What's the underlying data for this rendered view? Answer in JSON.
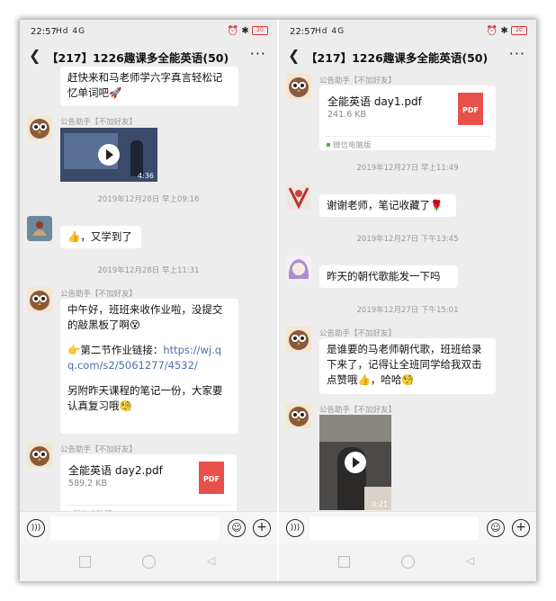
{
  "status": {
    "time": "22:57",
    "signal": "Hd 4G",
    "icons": "⏰ ✱",
    "battery": "20"
  },
  "chat": {
    "title": "【217】1226趣课多全能英语(50)",
    "back_icon": "chevron-left-icon",
    "more_icon": "more-icon"
  },
  "left": {
    "msg_top": "赶快来和马老师学六字真言轻松记忆单词吧🚀",
    "sender1": "公告助手【不加好友】",
    "video1_duration": "4:36",
    "time1": "2019年12月28日 早上09:16",
    "msg_student": "👍，又学到了",
    "time2": "2019年12月28日 早上11:31",
    "sender2": "公告助手【不加好友】",
    "msg_hw_1": "中午好，班班来收作业啦，没提交的敲黑板了啊😵",
    "msg_hw_2": "👉第二节作业链接：",
    "msg_hw_link": "https://wj.qq.com/s2/5061277/4532/",
    "msg_hw_3": "另附昨天课程的笔记一份，大家要认真复习哦🧐",
    "sender3": "公告助手【不加好友】",
    "file_name": "全能英语 day2.pdf",
    "file_size": "589.2 KB",
    "file_source": "微信电脑版",
    "pdf_label": "PDF"
  },
  "right": {
    "sender1": "公告助手【不加好友】",
    "file_name": "全能英语 day1.pdf",
    "file_size": "241.6 KB",
    "file_source": "微信电脑版",
    "pdf_label": "PDF",
    "time1": "2019年12月27日 早上11:49",
    "msg_thanks": "谢谢老师，笔记收藏了🌹",
    "time2": "2019年12月27日 下午13:45",
    "msg_song": "昨天的朝代歌能发一下吗",
    "time3": "2019年12月27日 下午15:01",
    "sender2": "公告助手【不加好友】",
    "msg_reply": "是谁要的马老师朝代歌，班班给录下来了，记得让全班同学给我双击点赞哦👍，哈哈🧐",
    "sender3": "公告助手【不加好友】",
    "video_duration": "0:21"
  },
  "input": {
    "voice_icon": "voice-icon",
    "emoji_icon": "emoji-icon",
    "plus_icon": "plus-icon"
  },
  "colors": {
    "background": "#ededed",
    "bubble": "#ffffff",
    "link": "#4a6fa5",
    "pdf": "#e8514b"
  }
}
